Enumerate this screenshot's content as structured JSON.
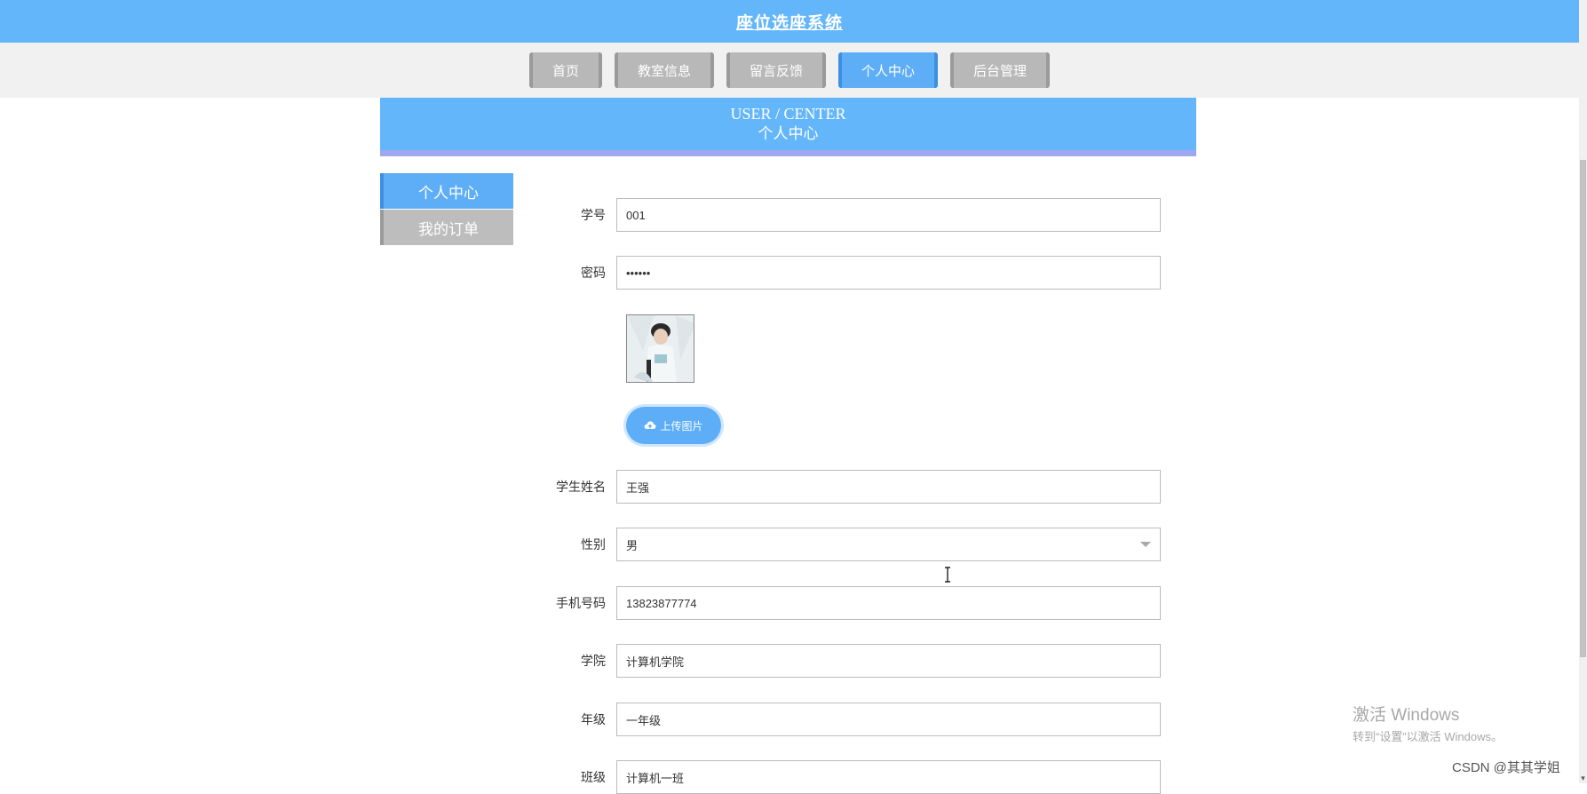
{
  "header": {
    "title": "座位选座系统"
  },
  "nav": {
    "items": [
      {
        "label": "首页"
      },
      {
        "label": "教室信息"
      },
      {
        "label": "留言反馈"
      },
      {
        "label": "个人中心"
      },
      {
        "label": "后台管理"
      }
    ],
    "active": "个人中心"
  },
  "banner": {
    "en": "USER / CENTER",
    "cn": "个人中心"
  },
  "side_menu": {
    "items": [
      {
        "label": "个人中心"
      },
      {
        "label": "我的订单"
      }
    ]
  },
  "form": {
    "student_id": {
      "label": "学号",
      "value": "001"
    },
    "password": {
      "label": "密码",
      "value": "••••••"
    },
    "upload_label": "上传图片",
    "student_name": {
      "label": "学生姓名",
      "value": "王强"
    },
    "gender": {
      "label": "性别",
      "value": "男"
    },
    "phone": {
      "label": "手机号码",
      "value": "13823877774"
    },
    "college": {
      "label": "学院",
      "value": "计算机学院"
    },
    "grade": {
      "label": "年级",
      "value": "一年级"
    },
    "class": {
      "label": "班级",
      "value": "计算机一班"
    }
  },
  "watermark": {
    "line1": "激活 Windows",
    "line2": "转到“设置”以激活 Windows。"
  },
  "credit": "CSDN @其其学姐",
  "colors": {
    "primary": "#64b6fb",
    "nav_inactive": "#b8b8b8",
    "banner_border": "#9ea7f0"
  }
}
